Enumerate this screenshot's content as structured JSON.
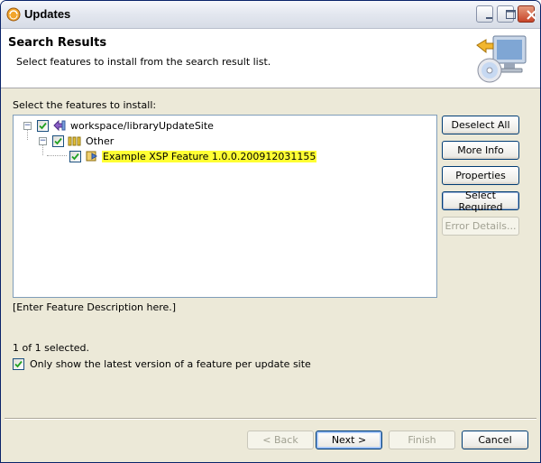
{
  "window": {
    "title": "Updates"
  },
  "header": {
    "title": "Search Results",
    "description": "Select features to install from the search result list."
  },
  "tree": {
    "label": "Select the features to install:",
    "nodes": [
      {
        "label": "workspace/libraryUpdateSite",
        "checked": true
      },
      {
        "label": "Other",
        "checked": true
      },
      {
        "label": "Example XSP Feature 1.0.0.200912031155",
        "checked": true,
        "selected": true
      }
    ]
  },
  "side_buttons": {
    "deselect_all": "Deselect All",
    "more_info": "More Info",
    "properties": "Properties",
    "select_required": "Select Required",
    "error_details": "Error Details..."
  },
  "feature_description": "[Enter Feature Description here.]",
  "selection_status": "1 of 1 selected.",
  "latest_version_option": {
    "label": "Only show the latest version of a feature per update site",
    "checked": true
  },
  "footer_buttons": {
    "back": "< Back",
    "next": "Next >",
    "finish": "Finish",
    "cancel": "Cancel"
  },
  "colors": {
    "selection_highlight": "#ffff33",
    "window_bg": "#ece9d8",
    "button_border": "#003c74"
  }
}
